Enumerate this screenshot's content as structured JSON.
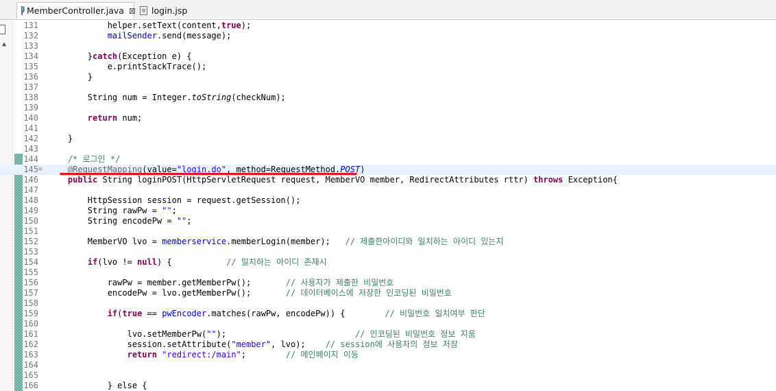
{
  "tabs": [
    {
      "label": "MemberController.java",
      "icon": "java-file-icon",
      "active": true
    },
    {
      "label": "login.jsp",
      "icon": "jsp-file-icon",
      "active": false
    }
  ],
  "tab_close_glyph": "⊠",
  "current_line": 145,
  "lines": [
    {
      "n": "131",
      "t": [
        [
          "",
          "            "
        ],
        [
          "",
          "helper.setText(content,"
        ],
        [
          "k",
          "true"
        ],
        [
          "",
          ");"
        ]
      ]
    },
    {
      "n": "132",
      "t": [
        [
          "",
          "            "
        ],
        [
          "f",
          "mailSender"
        ],
        [
          "",
          ".send(message);"
        ]
      ]
    },
    {
      "n": "133",
      "t": []
    },
    {
      "n": "134",
      "t": [
        [
          "",
          "        }"
        ],
        [
          "k",
          "catch"
        ],
        [
          "",
          "(Exception e) {"
        ]
      ]
    },
    {
      "n": "135",
      "t": [
        [
          "",
          "            e.printStackTrace();"
        ]
      ]
    },
    {
      "n": "136",
      "t": [
        [
          "",
          "        }"
        ]
      ]
    },
    {
      "n": "137",
      "t": []
    },
    {
      "n": "138",
      "t": [
        [
          "",
          "        String num = Integer."
        ],
        [
          "i",
          "toString"
        ],
        [
          "",
          "(checkNum);"
        ]
      ]
    },
    {
      "n": "139",
      "t": []
    },
    {
      "n": "140",
      "t": [
        [
          "",
          "        "
        ],
        [
          "k",
          "return"
        ],
        [
          "",
          " num;"
        ]
      ]
    },
    {
      "n": "141",
      "t": []
    },
    {
      "n": "142",
      "t": [
        [
          "",
          "    }"
        ]
      ]
    },
    {
      "n": "143",
      "t": []
    },
    {
      "n": "144",
      "t": [
        [
          "",
          "    "
        ],
        [
          "c",
          "/* 로그인 */"
        ]
      ]
    },
    {
      "n": "145",
      "fold": "⊖",
      "t": [
        [
          "",
          "    "
        ],
        [
          "a",
          "@RequestMapping"
        ],
        [
          "",
          "(value="
        ],
        [
          "s",
          "\"login.do\""
        ],
        [
          "",
          ", method=RequestMethod."
        ],
        [
          "fi",
          "POST"
        ],
        [
          "",
          ")"
        ]
      ]
    },
    {
      "n": "146",
      "t": [
        [
          "",
          "    "
        ],
        [
          "k",
          "public"
        ],
        [
          "",
          " String loginPOST(HttpServletRequest request, MemberVO member, RedirectAttributes rttr) "
        ],
        [
          "k",
          "throws"
        ],
        [
          "",
          " Exception{"
        ]
      ]
    },
    {
      "n": "147",
      "t": []
    },
    {
      "n": "148",
      "t": [
        [
          "",
          "        HttpSession session = request.getSession();"
        ]
      ]
    },
    {
      "n": "149",
      "t": [
        [
          "",
          "        String rawPw = "
        ],
        [
          "s",
          "\"\""
        ],
        [
          "",
          ";"
        ]
      ]
    },
    {
      "n": "150",
      "t": [
        [
          "",
          "        String encodePw = "
        ],
        [
          "s",
          "\"\""
        ],
        [
          "",
          ";"
        ]
      ]
    },
    {
      "n": "151",
      "t": []
    },
    {
      "n": "152",
      "t": [
        [
          "",
          "        MemberVO lvo = "
        ],
        [
          "f",
          "memberservice"
        ],
        [
          "",
          ".memberLogin(member);   "
        ],
        [
          "c",
          "// 제출한아이디와 일치하는 아이디 있는지"
        ]
      ]
    },
    {
      "n": "153",
      "t": []
    },
    {
      "n": "154",
      "t": [
        [
          "",
          "        "
        ],
        [
          "k",
          "if"
        ],
        [
          "",
          "(lvo != "
        ],
        [
          "k",
          "null"
        ],
        [
          "",
          ") {           "
        ],
        [
          "c",
          "// 일치하는 아이디 존재시"
        ]
      ]
    },
    {
      "n": "155",
      "t": []
    },
    {
      "n": "156",
      "t": [
        [
          "",
          "            rawPw = member.getMemberPw();       "
        ],
        [
          "c",
          "// 사용자가 제출한 비밀번호"
        ]
      ]
    },
    {
      "n": "157",
      "t": [
        [
          "",
          "            encodePw = lvo.getMemberPw();       "
        ],
        [
          "c",
          "// 데이터베이스에 저장한 인코딩된 비밀번호"
        ]
      ]
    },
    {
      "n": "158",
      "t": []
    },
    {
      "n": "159",
      "t": [
        [
          "",
          "            "
        ],
        [
          "k",
          "if"
        ],
        [
          "",
          "("
        ],
        [
          "k",
          "true"
        ],
        [
          "",
          " == "
        ],
        [
          "f",
          "pwEncoder"
        ],
        [
          "",
          ".matches(rawPw, encodePw)) {        "
        ],
        [
          "c",
          "// 비밀번호 일치여부 판단"
        ]
      ]
    },
    {
      "n": "160",
      "t": []
    },
    {
      "n": "161",
      "t": [
        [
          "",
          "                lvo.setMemberPw("
        ],
        [
          "s",
          "\"\""
        ],
        [
          "",
          ");                          "
        ],
        [
          "c",
          "// 인코딩된 비밀번호 정보 지움"
        ]
      ]
    },
    {
      "n": "162",
      "t": [
        [
          "",
          "                session.setAttribute("
        ],
        [
          "s",
          "\"member\""
        ],
        [
          "",
          ", lvo);    "
        ],
        [
          "c",
          "// session에 사용자의 정보 저장"
        ]
      ]
    },
    {
      "n": "163",
      "t": [
        [
          "",
          "                "
        ],
        [
          "k",
          "return"
        ],
        [
          "",
          " "
        ],
        [
          "s",
          "\"redirect:/main\""
        ],
        [
          "",
          ";        "
        ],
        [
          "c",
          "// 메인페이지 이동"
        ]
      ]
    },
    {
      "n": "164",
      "t": []
    },
    {
      "n": "165",
      "t": []
    },
    {
      "n": "166",
      "t": [
        [
          "",
          "            } else {"
        ]
      ]
    }
  ]
}
